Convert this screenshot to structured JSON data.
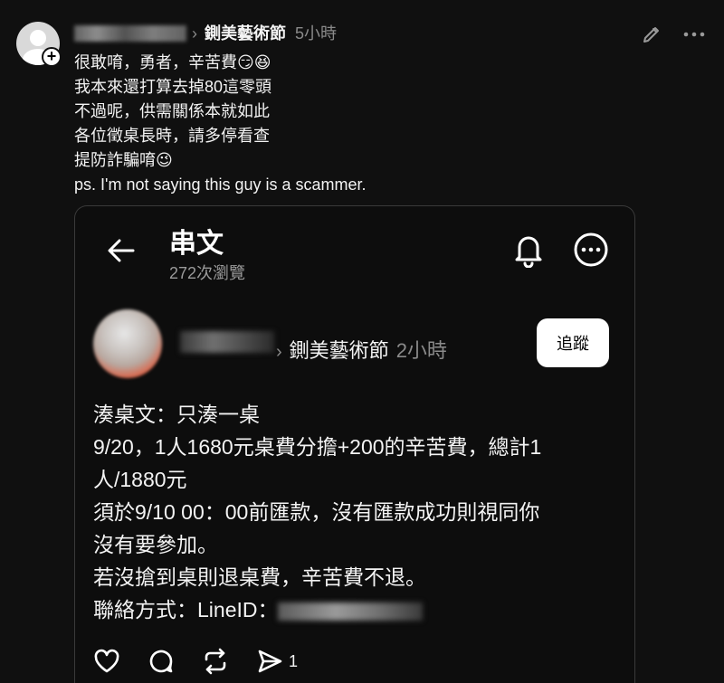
{
  "post": {
    "author_name": "",
    "group": "鍘美藝術節",
    "time": "5小時",
    "lines": [
      "很敢唷，勇者，辛苦費😏😆",
      "我本來還打算去掉80這零頭",
      "不過呢，供需關係本就如此",
      "各位徵桌長時，請多停看查",
      "提防詐騙唷😉",
      "ps. I'm not saying this guy is a scammer."
    ]
  },
  "card": {
    "title": "串文",
    "views": "272次瀏覽",
    "inner_group": "鍘美藝術節",
    "inner_time": "2小時",
    "follow_label": "追蹤",
    "lines": [
      "湊桌文：只湊一桌",
      "9/20，1人1680元桌費分擔+200的辛苦費，總計1",
      "人/1880元",
      "須於9/10 00：00前匯款，沒有匯款成功則視同你",
      "沒有要參加。",
      "若沒搶到桌則退桌費，辛苦費不退。"
    ],
    "contact_label": "聯絡方式：LineID：",
    "share_count": "1"
  },
  "icons": {
    "add": "plus-icon",
    "edit": "pencil-icon",
    "more": "more-dots-icon",
    "back": "arrow-left-icon",
    "bell": "bell-icon",
    "like": "heart-icon",
    "comment": "comment-icon",
    "repost": "repost-icon",
    "share": "send-icon"
  },
  "colors": {
    "background": "#101010",
    "text": "#f3f3f3",
    "muted": "#8a8a8a",
    "button": "#ffffff"
  }
}
